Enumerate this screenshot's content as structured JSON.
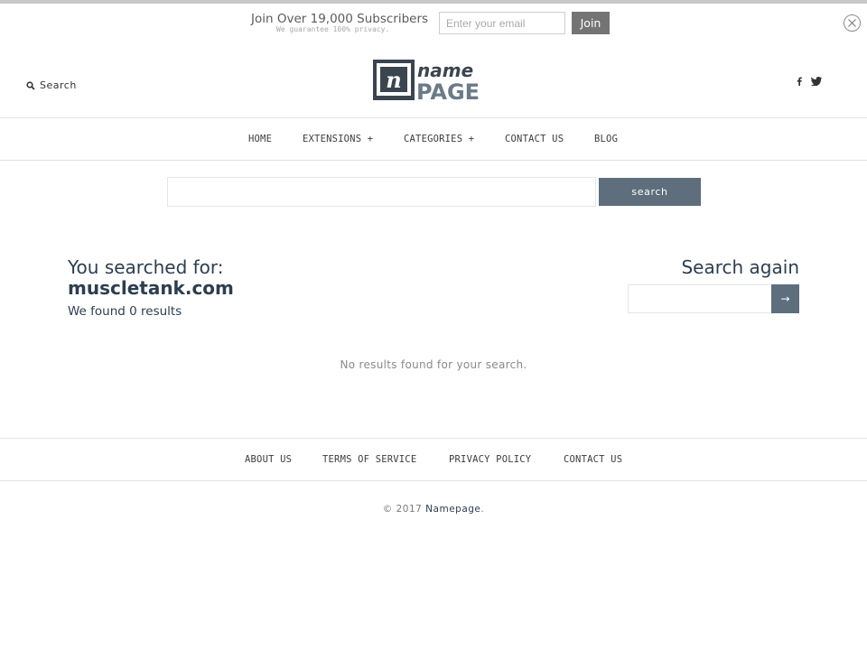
{
  "newsletter": {
    "title": "Join Over 19,000 Subscribers",
    "subtitle": "We guarantee 100% privacy.",
    "email_placeholder": "Enter your email",
    "join_label": "Join",
    "close_icon": "close-circle-icon"
  },
  "header": {
    "search_label": "Search",
    "search_icon": "search-icon",
    "logo": {
      "mark": "n",
      "top": "name",
      "bottom": "PAGE"
    },
    "social": [
      "facebook-icon",
      "twitter-icon"
    ]
  },
  "nav": {
    "items": [
      {
        "label": "HOME"
      },
      {
        "label": "EXTENSIONS +"
      },
      {
        "label": "CATEGORIES +"
      },
      {
        "label": "CONTACT US"
      },
      {
        "label": "BLOG"
      }
    ]
  },
  "main_search": {
    "value": "",
    "button_label": "search"
  },
  "results": {
    "heading": "You searched for:",
    "query": "muscletank.com",
    "count_text": "We found 0 results",
    "empty_message": "No results found for your search."
  },
  "search_again": {
    "title": "Search again",
    "value": "",
    "button_label": "→"
  },
  "footer": {
    "links": [
      {
        "label": "ABOUT US"
      },
      {
        "label": "TERMS OF SERVICE"
      },
      {
        "label": "PRIVACY POLICY"
      },
      {
        "label": "CONTACT US"
      }
    ],
    "copyright_prefix": "© 2017",
    "brand": "Namepage",
    "copyright_suffix": "."
  },
  "colors": {
    "accent": "#5e6e7c",
    "heading": "#2d3e4f",
    "logo_dark": "#3b4550",
    "logo_light": "#6b7a88"
  }
}
